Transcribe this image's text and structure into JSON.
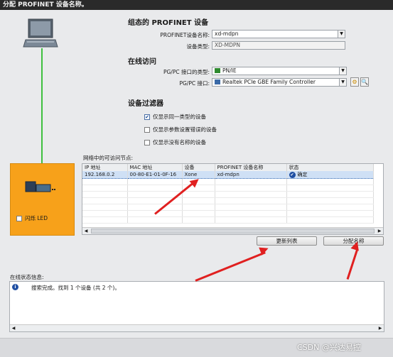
{
  "title": "分配 PROFINET 设备名称。",
  "config": {
    "heading": "组态的 PROFINET 设备",
    "name_label": "PROFINET设备名称:",
    "name_value": "xd-mdpn",
    "type_label": "设备类型:",
    "type_value": "XD-MDPN"
  },
  "online": {
    "heading": "在线访问",
    "iface_type_label": "PG/PC 接口的类型:",
    "iface_type_value": "PN/IE",
    "iface_label": "PG/PC 接口:",
    "iface_value": "Realtek PCIe GBE Family Controller"
  },
  "filter": {
    "heading": "设备过滤器",
    "options": [
      {
        "label": "仅显示同一类型的设备",
        "checked": true
      },
      {
        "label": "仅显示参数设置错误的设备",
        "checked": false
      },
      {
        "label": "仅显示没有名称的设备",
        "checked": false
      }
    ]
  },
  "nodes": {
    "heading": "网络中的可访问节点:",
    "columns": [
      "IP 地址",
      "MAC 地址",
      "设备",
      "PROFINET 设备名称",
      "状态"
    ],
    "rows": [
      {
        "ip": "192.168.0.2",
        "mac": "00-80-E1-01-0F-16",
        "device": "Xone",
        "name": "xd-mdpn",
        "status": "确定"
      }
    ]
  },
  "flash_led_label": "闪烁 LED",
  "buttons": {
    "refresh": "更新列表",
    "assign": "分配名称"
  },
  "status_info": {
    "heading": "在线状态信息:",
    "message": "搜索完成。找到 1 个设备 (共 2 个)。"
  },
  "watermark": "CSDN @兴达易控",
  "colors": {
    "orange_panel": "#f7a11a",
    "network_line": "#3fc03f",
    "selection": "#cfe0f5",
    "arrows": "#e02020"
  }
}
